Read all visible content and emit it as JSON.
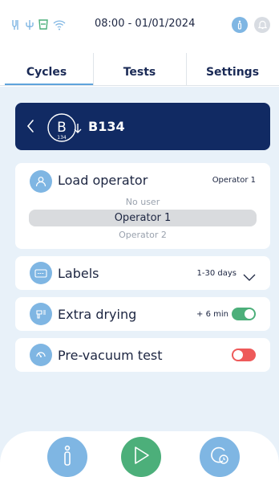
{
  "status_bar": {
    "datetime": "08:00 - 01/01/2024",
    "icons": [
      "usb-connection-icon",
      "usb-icon",
      "water-level-icon",
      "wifi-icon"
    ],
    "info_icon": "info-icon",
    "bell_icon": "bell-icon"
  },
  "tabs": [
    {
      "label": "Cycles",
      "active": true
    },
    {
      "label": "Tests",
      "active": false
    },
    {
      "label": "Settings",
      "active": false
    }
  ],
  "cycle": {
    "logo_letter": "B",
    "logo_number": "134",
    "name": "B134"
  },
  "load_operator": {
    "label": "Load operator",
    "value": "Operator 1",
    "options": [
      "No user",
      "Operator 1",
      "Operator 2"
    ],
    "selected": "Operator 1"
  },
  "labels_row": {
    "label": "Labels",
    "value": "1-30 days"
  },
  "extra_drying": {
    "label": "Extra drying",
    "value": "+ 6 min",
    "enabled": true
  },
  "pre_vacuum": {
    "label": "Pre-vacuum test",
    "enabled": false
  },
  "colors": {
    "accent": "#7fb6e3",
    "navy": "#112a63",
    "toggle_on": "#4caf7a",
    "toggle_off": "#ee5a5a",
    "play": "#4caf7a"
  }
}
